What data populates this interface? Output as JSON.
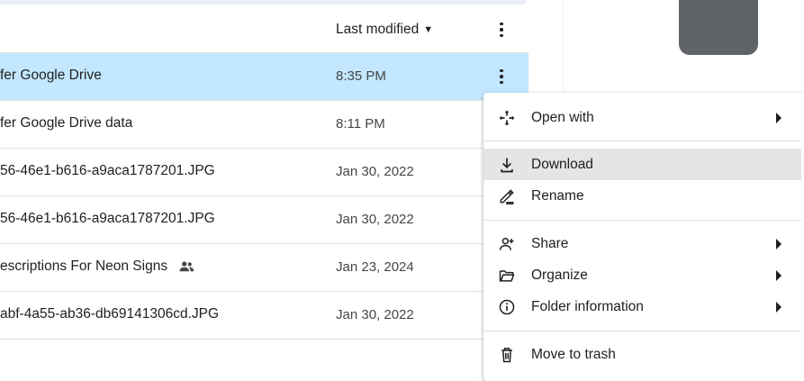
{
  "list": {
    "sort_label": "Last modified",
    "sort_direction_icon": "caret-down-icon",
    "rows": [
      {
        "name": "fer Google Drive",
        "date": "8:35 PM",
        "selected": true,
        "shared": false
      },
      {
        "name": "fer Google Drive data",
        "date": "8:11 PM",
        "selected": false,
        "shared": false
      },
      {
        "name": "56-46e1-b616-a9aca1787201.JPG",
        "date": "Jan 30, 2022",
        "selected": false,
        "shared": false
      },
      {
        "name": "56-46e1-b616-a9aca1787201.JPG",
        "date": "Jan 30, 2022",
        "selected": false,
        "shared": false
      },
      {
        "name": "escriptions For Neon Signs",
        "date": "Jan 23, 2024",
        "selected": false,
        "shared": true
      },
      {
        "name": "abf-4a55-ab36-db69141306cd.JPG",
        "date": "Jan 30, 2022",
        "selected": false,
        "shared": false
      }
    ]
  },
  "menu": {
    "items": [
      {
        "label": "Open with",
        "icon": "move-arrows-icon",
        "submenu": true
      },
      {
        "label": "Download",
        "icon": "download-icon",
        "submenu": false
      },
      {
        "label": "Rename",
        "icon": "rename-pencil-icon",
        "submenu": false
      },
      {
        "label": "Share",
        "icon": "share-person-add-icon",
        "submenu": true
      },
      {
        "label": "Organize",
        "icon": "folder-open-icon",
        "submenu": true
      },
      {
        "label": "Folder information",
        "icon": "info-icon",
        "submenu": true
      },
      {
        "label": "Move to trash",
        "icon": "trash-icon",
        "submenu": false
      }
    ]
  },
  "colors": {
    "selected_row": "#c2e7ff",
    "menu_hover": "#e5e5e5",
    "thumbnail": "#606367"
  }
}
